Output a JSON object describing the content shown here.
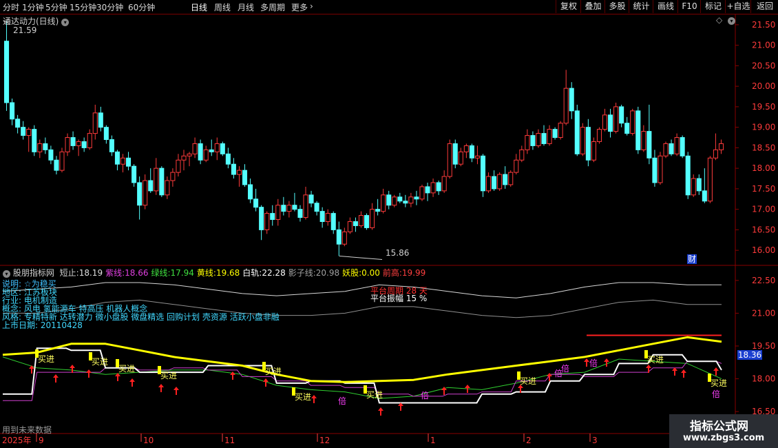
{
  "toolbar": {
    "periods": [
      "分时",
      "1分钟",
      "5分钟",
      "15分钟",
      "30分钟",
      "60分钟",
      "日线",
      "周线",
      "月线",
      "多周期",
      "更多"
    ],
    "active_period": "日线",
    "more_icon": "chevron-right-icon",
    "buttons": [
      "复权",
      "叠加",
      "多股",
      "统计",
      "画线",
      "F10",
      "标记",
      "+自选",
      "返回"
    ]
  },
  "main_panel": {
    "title": "通达动力(日线)",
    "collapse_icon": "chevron-down-icon",
    "diamond_icon": "diamond-icon",
    "high_label": "21.59",
    "low_label": "15.86",
    "finance_badge": "财",
    "y_ticks": [
      "21.50",
      "21.00",
      "20.50",
      "20.00",
      "19.50",
      "19.00",
      "18.50",
      "18.00",
      "17.50",
      "17.00",
      "16.50",
      "16.00"
    ]
  },
  "indicator_panel": {
    "title": "股朋指标网",
    "values": [
      {
        "label": "短止:",
        "value": "18.19",
        "color": "#e0e0e0"
      },
      {
        "label": "紫线:",
        "value": "18.66",
        "color": "#e040e0"
      },
      {
        "label": "绿线:",
        "value": "17.94",
        "color": "#40e040"
      },
      {
        "label": "黄线:",
        "value": "19.68",
        "color": "#ffff00"
      },
      {
        "label": "白轨:",
        "value": "22.28",
        "color": "#ffffff"
      },
      {
        "label": "影子线:",
        "value": "20.98",
        "color": "#a0a0a0"
      },
      {
        "label": "妖股:",
        "value": "0.00",
        "color": "#ffff00"
      },
      {
        "label": "前高:",
        "value": "19.99",
        "color": "#ff4040"
      }
    ],
    "info_lines": [
      "说明: ☆为稳买",
      "地区:     江苏板块",
      "行业:     电机制造",
      "概念:     风电 氢能源车 特高压 机器人概念",
      "风格:     专精特新 达转潜力 微小盘股 微盘精选 回购计划 壳资源 活跃小盘非融",
      "上市日期: 20110428"
    ],
    "platform_period": "平台周期 28 天",
    "platform_amplitude": "平台振幅 15 %",
    "buy_label": "买进",
    "double_label": "倍",
    "current_value": "18.36",
    "y_ticks": [
      "22.50",
      "21.00",
      "19.50",
      "18.00",
      "16.50"
    ],
    "footer_note": "用到未来数据"
  },
  "xaxis": {
    "year": "2025年",
    "months": [
      "9",
      "10",
      "11",
      "12",
      "1",
      "2",
      "3"
    ]
  },
  "watermark": {
    "line1": "指标公式网",
    "line2": "www.zbgs3.com"
  },
  "colors": {
    "up": "#ff3b3b",
    "down": "#54ffff",
    "grid": "#8a0000",
    "accent": "#ffff00"
  },
  "chart_data": {
    "type": "candlestick",
    "ohlc": [
      [
        21.1,
        21.59,
        19.4,
        19.6
      ],
      [
        19.6,
        19.7,
        19.05,
        19.2
      ],
      [
        19.2,
        19.3,
        18.85,
        19.0
      ],
      [
        19.0,
        19.15,
        18.7,
        18.8
      ],
      [
        18.8,
        19.0,
        18.4,
        18.95
      ],
      [
        18.95,
        19.05,
        18.3,
        18.4
      ],
      [
        18.4,
        18.7,
        18.25,
        18.6
      ],
      [
        18.6,
        18.75,
        18.35,
        18.45
      ],
      [
        18.45,
        18.55,
        18.1,
        18.2
      ],
      [
        18.2,
        18.3,
        17.85,
        17.95
      ],
      [
        17.95,
        18.5,
        17.9,
        18.4
      ],
      [
        18.4,
        18.85,
        18.3,
        18.75
      ],
      [
        18.75,
        18.9,
        18.45,
        18.55
      ],
      [
        18.55,
        18.7,
        18.3,
        18.65
      ],
      [
        18.65,
        18.75,
        18.4,
        18.5
      ],
      [
        18.5,
        18.95,
        18.45,
        18.85
      ],
      [
        18.85,
        19.55,
        18.7,
        19.35
      ],
      [
        19.35,
        19.5,
        18.9,
        19.0
      ],
      [
        19.0,
        19.05,
        18.6,
        18.7
      ],
      [
        18.7,
        18.8,
        18.3,
        18.4
      ],
      [
        18.4,
        18.45,
        17.95,
        18.1
      ],
      [
        18.1,
        18.35,
        17.9,
        18.25
      ],
      [
        18.25,
        18.4,
        17.95,
        18.05
      ],
      [
        18.05,
        18.1,
        17.55,
        17.65
      ],
      [
        17.65,
        17.8,
        16.75,
        17.1
      ],
      [
        17.1,
        17.85,
        17.0,
        17.7
      ],
      [
        17.7,
        18.0,
        17.4,
        17.45
      ],
      [
        17.45,
        18.25,
        17.35,
        18.0
      ],
      [
        18.0,
        18.05,
        17.3,
        17.35
      ],
      [
        17.35,
        17.8,
        17.25,
        17.7
      ],
      [
        17.7,
        18.0,
        17.55,
        17.9
      ],
      [
        17.9,
        18.35,
        17.8,
        18.2
      ],
      [
        18.2,
        18.45,
        17.95,
        18.3
      ],
      [
        18.3,
        18.4,
        18.05,
        18.35
      ],
      [
        18.35,
        18.75,
        18.25,
        18.6
      ],
      [
        18.6,
        18.7,
        18.1,
        18.2
      ],
      [
        18.2,
        18.55,
        18.15,
        18.45
      ],
      [
        18.45,
        18.7,
        18.3,
        18.4
      ],
      [
        18.4,
        18.75,
        18.2,
        18.6
      ],
      [
        18.6,
        18.65,
        18.3,
        18.35
      ],
      [
        18.35,
        18.5,
        18.0,
        18.1
      ],
      [
        18.1,
        18.25,
        17.75,
        17.85
      ],
      [
        17.85,
        18.05,
        17.55,
        17.95
      ],
      [
        17.95,
        18.1,
        17.55,
        17.6
      ],
      [
        17.6,
        17.75,
        17.15,
        17.25
      ],
      [
        17.25,
        17.5,
        16.95,
        17.05
      ],
      [
        17.05,
        17.1,
        16.25,
        16.5
      ],
      [
        16.5,
        16.95,
        16.4,
        16.9
      ],
      [
        16.9,
        17.1,
        16.6,
        16.75
      ],
      [
        16.75,
        17.25,
        16.6,
        17.1
      ],
      [
        17.1,
        17.3,
        16.85,
        16.95
      ],
      [
        16.95,
        17.2,
        16.8,
        17.1
      ],
      [
        17.1,
        17.4,
        16.95,
        17.0
      ],
      [
        17.0,
        17.1,
        16.7,
        16.8
      ],
      [
        16.8,
        17.55,
        16.75,
        17.35
      ],
      [
        17.35,
        17.45,
        17.05,
        17.15
      ],
      [
        17.15,
        17.2,
        16.85,
        16.95
      ],
      [
        16.95,
        17.05,
        16.55,
        16.7
      ],
      [
        16.7,
        17.0,
        16.6,
        16.9
      ],
      [
        16.9,
        16.95,
        16.4,
        16.5
      ],
      [
        16.5,
        16.7,
        15.86,
        16.15
      ],
      [
        16.15,
        16.55,
        16.1,
        16.45
      ],
      [
        16.45,
        16.8,
        16.4,
        16.7
      ],
      [
        16.7,
        16.8,
        16.45,
        16.6
      ],
      [
        16.6,
        16.95,
        16.55,
        16.85
      ],
      [
        16.85,
        16.9,
        16.5,
        16.55
      ],
      [
        16.55,
        17.15,
        16.5,
        17.0
      ],
      [
        17.0,
        17.25,
        16.85,
        16.95
      ],
      [
        16.95,
        17.5,
        16.9,
        17.35
      ],
      [
        17.35,
        17.45,
        17.0,
        17.1
      ],
      [
        17.1,
        17.35,
        17.05,
        17.3
      ],
      [
        17.3,
        17.4,
        17.15,
        17.2
      ],
      [
        17.2,
        17.35,
        17.05,
        17.15
      ],
      [
        17.15,
        17.4,
        17.05,
        17.3
      ],
      [
        17.3,
        17.45,
        17.1,
        17.25
      ],
      [
        17.25,
        17.6,
        17.2,
        17.55
      ],
      [
        17.55,
        17.65,
        17.2,
        17.4
      ],
      [
        17.4,
        17.75,
        17.3,
        17.65
      ],
      [
        17.65,
        17.7,
        17.35,
        17.45
      ],
      [
        17.45,
        17.95,
        17.4,
        17.8
      ],
      [
        17.8,
        18.7,
        17.75,
        18.6
      ],
      [
        18.6,
        18.7,
        18.0,
        18.1
      ],
      [
        18.1,
        18.5,
        18.05,
        18.4
      ],
      [
        18.4,
        18.6,
        18.25,
        18.55
      ],
      [
        18.55,
        18.6,
        18.15,
        18.25
      ],
      [
        18.25,
        18.55,
        18.1,
        18.3
      ],
      [
        18.3,
        18.35,
        17.3,
        17.45
      ],
      [
        17.45,
        17.9,
        17.4,
        17.8
      ],
      [
        17.8,
        17.95,
        17.45,
        17.5
      ],
      [
        17.5,
        17.9,
        17.45,
        17.85
      ],
      [
        17.85,
        18.05,
        17.5,
        17.6
      ],
      [
        17.6,
        17.95,
        17.55,
        17.9
      ],
      [
        17.9,
        18.35,
        17.85,
        18.2
      ],
      [
        18.2,
        18.55,
        18.15,
        18.45
      ],
      [
        18.45,
        18.95,
        18.35,
        18.8
      ],
      [
        18.8,
        18.9,
        18.45,
        18.55
      ],
      [
        18.55,
        18.95,
        18.5,
        18.85
      ],
      [
        18.85,
        19.05,
        18.55,
        18.6
      ],
      [
        18.6,
        19.05,
        18.55,
        18.95
      ],
      [
        18.95,
        19.0,
        18.7,
        18.75
      ],
      [
        18.75,
        19.15,
        18.7,
        19.1
      ],
      [
        19.1,
        20.4,
        19.05,
        19.95
      ],
      [
        19.95,
        20.1,
        19.2,
        19.4
      ],
      [
        19.4,
        19.55,
        18.3,
        18.35
      ],
      [
        18.35,
        19.1,
        18.3,
        19.0
      ],
      [
        19.0,
        19.2,
        18.05,
        18.2
      ],
      [
        18.2,
        18.75,
        18.15,
        18.65
      ],
      [
        18.65,
        19.0,
        18.6,
        18.95
      ],
      [
        18.95,
        19.45,
        18.9,
        19.3
      ],
      [
        19.3,
        19.45,
        18.75,
        18.9
      ],
      [
        18.9,
        19.6,
        18.85,
        19.5
      ],
      [
        19.5,
        19.55,
        19.0,
        19.1
      ],
      [
        19.1,
        19.25,
        18.8,
        18.85
      ],
      [
        18.85,
        19.45,
        18.8,
        19.4
      ],
      [
        19.4,
        19.5,
        18.35,
        18.45
      ],
      [
        18.45,
        19.05,
        18.4,
        18.9
      ],
      [
        18.9,
        19.55,
        18.1,
        18.25
      ],
      [
        18.25,
        18.45,
        17.55,
        17.65
      ],
      [
        17.65,
        18.4,
        17.6,
        18.3
      ],
      [
        18.3,
        18.65,
        18.25,
        18.6
      ],
      [
        18.6,
        18.7,
        18.3,
        18.35
      ],
      [
        18.35,
        18.85,
        18.3,
        18.75
      ],
      [
        18.75,
        18.8,
        18.25,
        18.3
      ],
      [
        18.3,
        18.4,
        17.25,
        17.35
      ],
      [
        17.35,
        17.85,
        17.3,
        17.75
      ],
      [
        17.75,
        17.85,
        17.35,
        17.45
      ],
      [
        17.45,
        18.0,
        17.15,
        17.2
      ],
      [
        17.2,
        18.3,
        17.15,
        18.25
      ],
      [
        18.25,
        18.85,
        18.2,
        18.45
      ],
      [
        18.45,
        18.7,
        18.35,
        18.6
      ]
    ],
    "y_range": [
      15.7,
      21.7
    ],
    "indicator_lines": {
      "white_band": [
        22.0,
        22.1,
        22.2,
        22.4,
        22.4,
        22.3,
        22.1,
        21.9,
        21.8,
        21.9,
        22.0,
        22.3,
        22.2,
        22.0,
        21.8,
        21.7,
        21.9,
        22.2,
        22.4,
        22.4,
        22.3,
        22.3
      ],
      "shadow_line": [
        21.0,
        21.0,
        21.2,
        21.5,
        21.6,
        21.4,
        21.2,
        21.0,
        20.9,
        20.9,
        21.0,
        21.3,
        21.3,
        21.1,
        20.9,
        20.8,
        20.9,
        21.2,
        21.5,
        21.6,
        21.4,
        21.4
      ],
      "yellow_line": [
        19.1,
        19.2,
        19.6,
        19.6,
        19.3,
        19.0,
        18.8,
        18.6,
        18.2,
        17.9,
        17.85,
        17.9,
        17.95,
        18.2,
        18.4,
        18.6,
        18.8,
        19.0,
        19.3,
        19.6,
        19.9,
        19.7
      ],
      "white_line": [
        17.3,
        19.4,
        19.3,
        18.5,
        18.3,
        18.3,
        18.6,
        18.6,
        17.8,
        17.9,
        17.8,
        16.9,
        16.9,
        16.9,
        17.3,
        17.4,
        17.9,
        18.2,
        18.7,
        19.1,
        18.8,
        18.4
      ],
      "purple_line": [
        17.0,
        18.3,
        18.3,
        18.5,
        18.4,
        18.5,
        18.4,
        18.1,
        17.9,
        17.7,
        17.6,
        17.3,
        17.2,
        17.3,
        17.4,
        17.9,
        18.2,
        18.1,
        18.3,
        18.5,
        18.8,
        18.7
      ],
      "green_line": [
        19.0,
        18.5,
        18.4,
        18.2,
        18.3,
        18.4,
        18.4,
        18.2,
        17.7,
        17.5,
        17.4,
        17.1,
        17.2,
        17.6,
        17.5,
        17.8,
        18.2,
        18.3,
        18.9,
        18.8,
        18.7,
        18.0
      ],
      "prev_high": 19.99
    }
  }
}
